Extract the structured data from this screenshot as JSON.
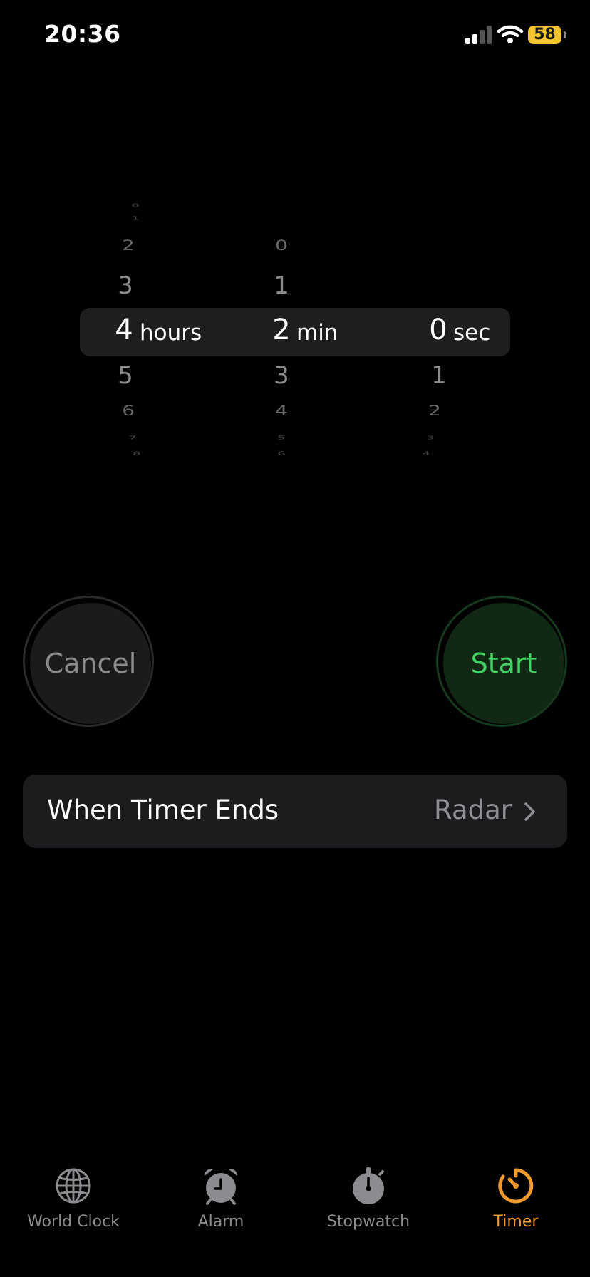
{
  "status_bar": {
    "time": "20:36",
    "battery": "58"
  },
  "picker": {
    "hours": {
      "above": [
        "0",
        "1",
        "2",
        "3"
      ],
      "selected": "4",
      "unit": "hours",
      "below": [
        "5",
        "6",
        "7",
        "8"
      ]
    },
    "minutes": {
      "above": [
        "0",
        "1"
      ],
      "selected": "2",
      "unit": "min",
      "below": [
        "3",
        "4",
        "5",
        "6"
      ]
    },
    "seconds": {
      "above": [],
      "selected": "0",
      "unit": "sec",
      "below": [
        "1",
        "2",
        "3",
        "4"
      ]
    }
  },
  "buttons": {
    "cancel": "Cancel",
    "start": "Start"
  },
  "timer_end": {
    "label": "When Timer Ends",
    "value": "Radar"
  },
  "tabs": [
    {
      "label": "World Clock",
      "icon": "globe-icon",
      "active": false
    },
    {
      "label": "Alarm",
      "icon": "alarm-clock-icon",
      "active": false
    },
    {
      "label": "Stopwatch",
      "icon": "stopwatch-icon",
      "active": false
    },
    {
      "label": "Timer",
      "icon": "timer-icon",
      "active": true
    }
  ],
  "colors": {
    "accent": "#f29a2d",
    "start_green": "#45d265",
    "battery": "#f4c330"
  }
}
